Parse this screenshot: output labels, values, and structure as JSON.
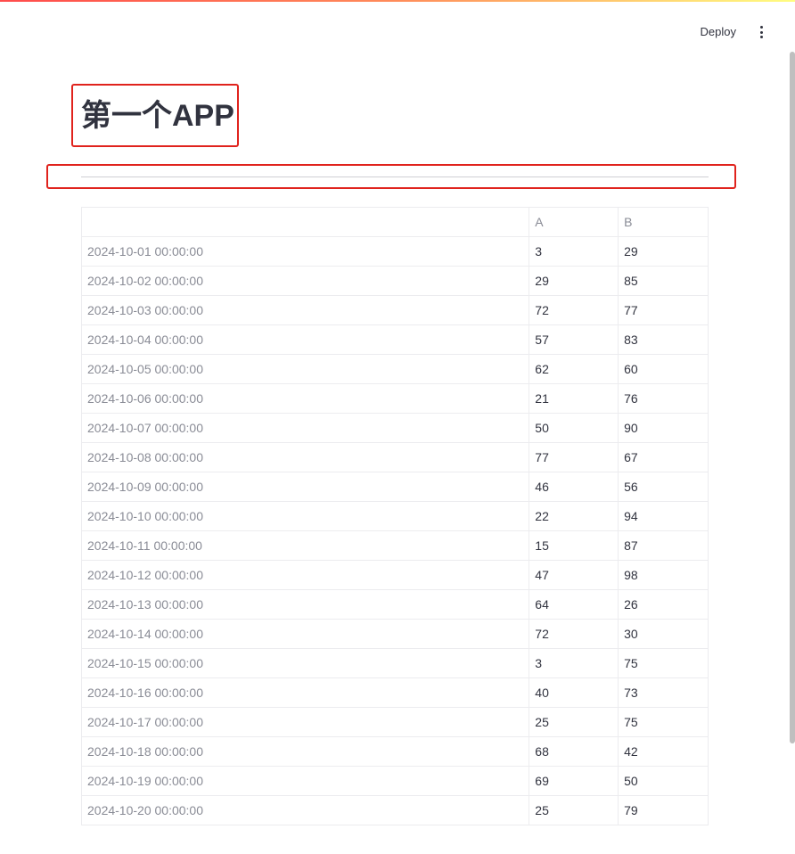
{
  "header": {
    "deploy_label": "Deploy",
    "menu_icon": "vertical-dots-icon"
  },
  "main": {
    "title": "第一个APP"
  },
  "table": {
    "columns": [
      "",
      "A",
      "B"
    ],
    "rows": [
      {
        "index": "2024-10-01 00:00:00",
        "A": "3",
        "B": "29"
      },
      {
        "index": "2024-10-02 00:00:00",
        "A": "29",
        "B": "85"
      },
      {
        "index": "2024-10-03 00:00:00",
        "A": "72",
        "B": "77"
      },
      {
        "index": "2024-10-04 00:00:00",
        "A": "57",
        "B": "83"
      },
      {
        "index": "2024-10-05 00:00:00",
        "A": "62",
        "B": "60"
      },
      {
        "index": "2024-10-06 00:00:00",
        "A": "21",
        "B": "76"
      },
      {
        "index": "2024-10-07 00:00:00",
        "A": "50",
        "B": "90"
      },
      {
        "index": "2024-10-08 00:00:00",
        "A": "77",
        "B": "67"
      },
      {
        "index": "2024-10-09 00:00:00",
        "A": "46",
        "B": "56"
      },
      {
        "index": "2024-10-10 00:00:00",
        "A": "22",
        "B": "94"
      },
      {
        "index": "2024-10-11 00:00:00",
        "A": "15",
        "B": "87"
      },
      {
        "index": "2024-10-12 00:00:00",
        "A": "47",
        "B": "98"
      },
      {
        "index": "2024-10-13 00:00:00",
        "A": "64",
        "B": "26"
      },
      {
        "index": "2024-10-14 00:00:00",
        "A": "72",
        "B": "30"
      },
      {
        "index": "2024-10-15 00:00:00",
        "A": "3",
        "B": "75"
      },
      {
        "index": "2024-10-16 00:00:00",
        "A": "40",
        "B": "73"
      },
      {
        "index": "2024-10-17 00:00:00",
        "A": "25",
        "B": "75"
      },
      {
        "index": "2024-10-18 00:00:00",
        "A": "68",
        "B": "42"
      },
      {
        "index": "2024-10-19 00:00:00",
        "A": "69",
        "B": "50"
      },
      {
        "index": "2024-10-20 00:00:00",
        "A": "25",
        "B": "79"
      }
    ]
  },
  "colors": {
    "highlight_border": "#e0231d",
    "text": "#31333f",
    "muted_text": "#8a8c96",
    "grid": "#ececef"
  }
}
